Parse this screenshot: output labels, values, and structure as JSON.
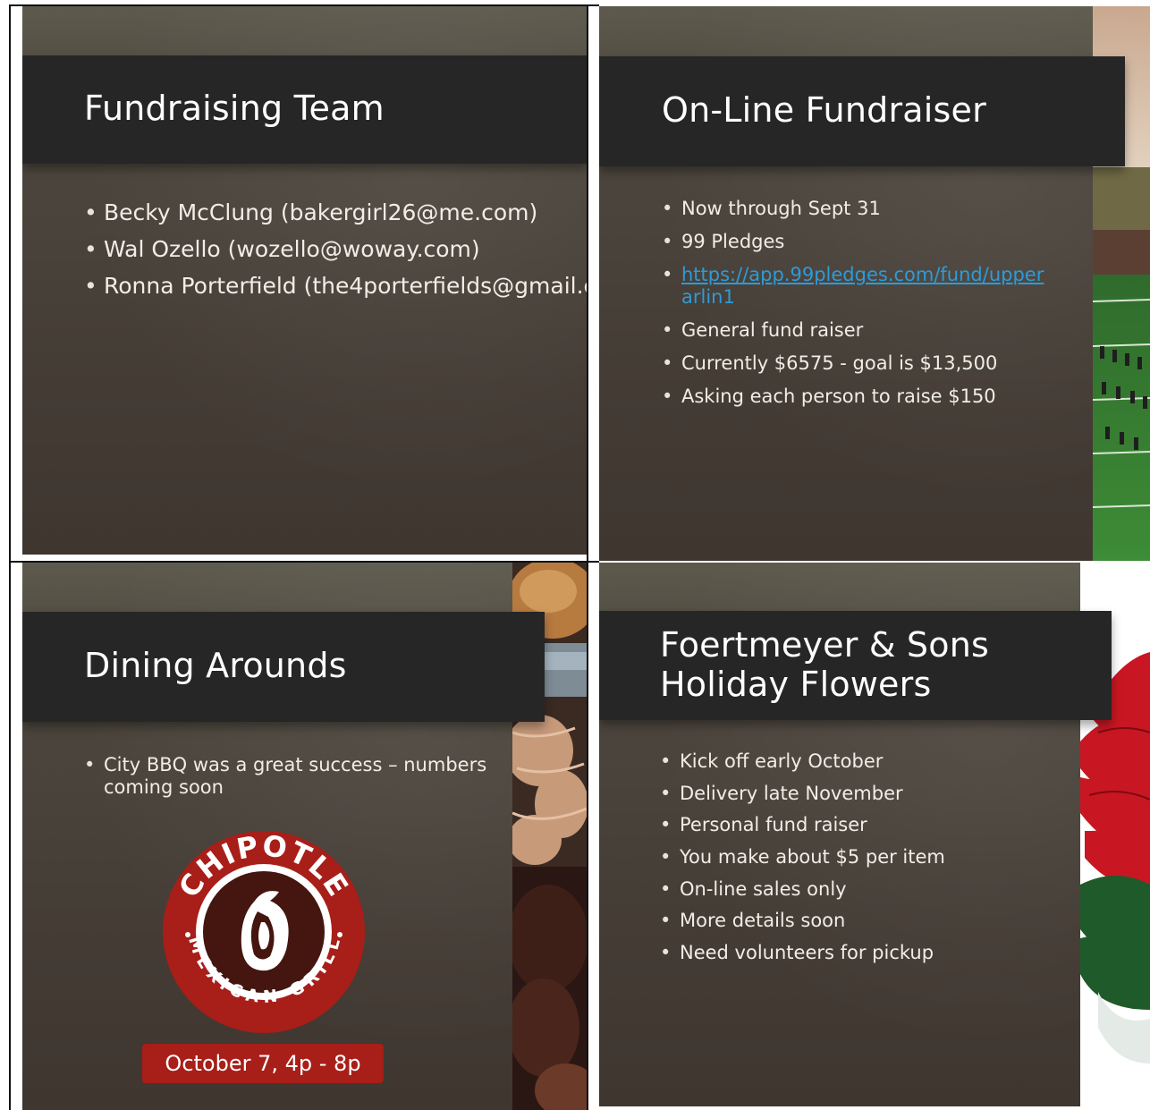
{
  "slides": [
    {
      "title": "Fundraising Team",
      "bullets": [
        "Becky McClung (bakergirl26@me.com)",
        "Wal Ozello (wozello@woway.com)",
        "Ronna Porterfield (the4porterfields@gmail.c"
      ]
    },
    {
      "title": "On-Line Fundraiser",
      "bullets": [
        "Now through Sept 31",
        "99 Pledges"
      ],
      "link_line1": "https://app.99pledges.com/fund/upper",
      "link_line2": "arlin1",
      "bullets_after": [
        "General fund raiser",
        "Currently $6575 - goal is $13,500",
        "Asking each person to raise $150"
      ],
      "photo": "marching-band-field-photo"
    },
    {
      "title": "Dining Arounds",
      "bullet_line1": "City BBQ was a great success – numbers",
      "bullet_line2": "coming soon",
      "logo_text_top": "CHIPOTLE",
      "logo_text_bottom": "MEXICAN GRILL",
      "date": "October 7, 4p - 8p",
      "photo": "bbq-food-photo",
      "colors": {
        "logo_red": "#a81e18",
        "logo_brown": "#45150f"
      }
    },
    {
      "title_line1": "Foertmeyer & Sons",
      "title_line2": "Holiday Flowers",
      "bullets": [
        "Kick off early October",
        "Delivery late November",
        "Personal fund raiser",
        "You make about $5 per item",
        "On-line sales only",
        "More details soon",
        "Need volunteers for pickup"
      ],
      "photo": "poinsettia-photo"
    }
  ]
}
